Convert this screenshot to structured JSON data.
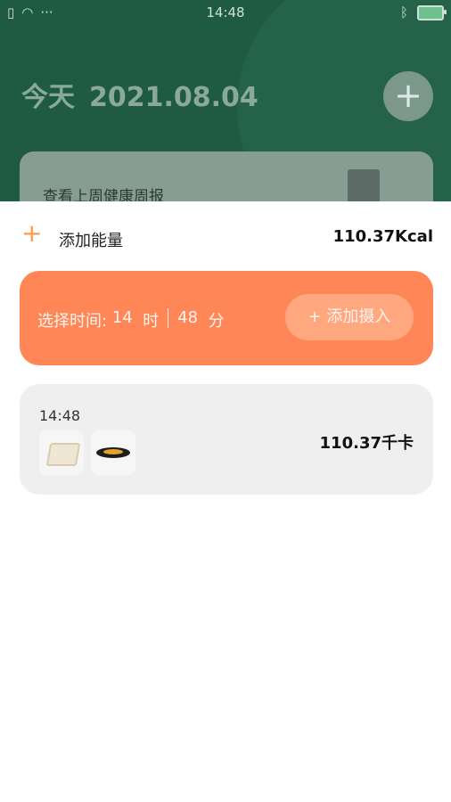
{
  "statusbar": {
    "time": "14:48",
    "left_icons": [
      "sim-icon",
      "wifi-icon",
      "more-dots-icon"
    ],
    "right_icons": [
      "bluetooth-icon",
      "battery-icon"
    ]
  },
  "background": {
    "today_label": "今天",
    "date": "2021.08.04",
    "report_title": "查看上周健康周报"
  },
  "sheet": {
    "add_energy_label": "添加能量",
    "total_value": "110.37Kcal",
    "time_picker": {
      "prefix": "选择时间:",
      "hour": "14",
      "hour_unit": "时",
      "minute": "48",
      "minute_unit": "分"
    },
    "add_intake_label": "+ 添加摄入",
    "record": {
      "time": "14:48",
      "kcal": "110.37千卡",
      "thumbnails": [
        "tofu",
        "dish"
      ]
    }
  },
  "colors": {
    "bg_green": "#1f5a43",
    "accent_orange": "#ff8656",
    "plus_orange": "#ff9a4a",
    "card_gray": "#efefef"
  }
}
